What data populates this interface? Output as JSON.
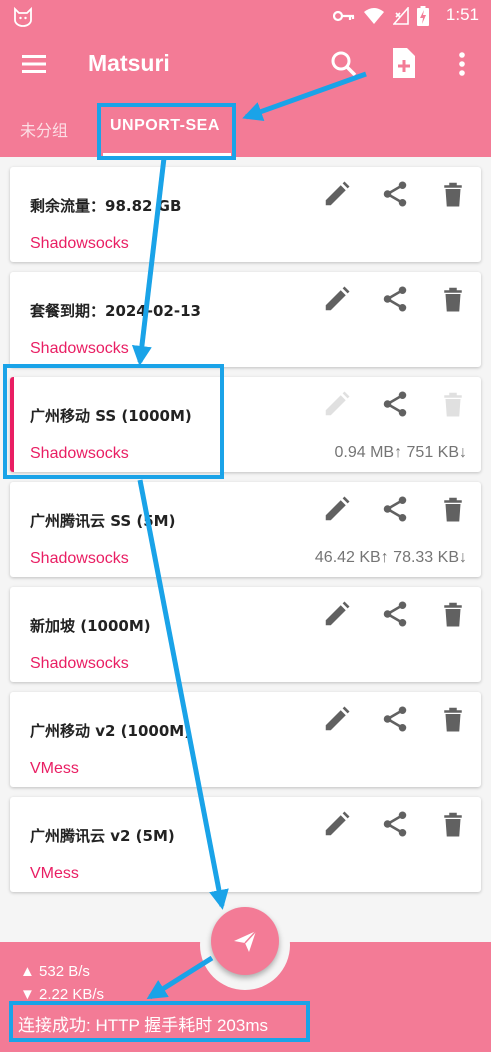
{
  "status_bar": {
    "time": "1:51",
    "icons": [
      "cat-icon",
      "key-icon",
      "wifi-icon",
      "no-sim-icon",
      "battery-charging-icon"
    ]
  },
  "app_bar": {
    "title": "Matsuri",
    "icons": [
      "menu-icon",
      "search-icon",
      "add-file-icon",
      "more-vert-icon"
    ]
  },
  "tabs": [
    {
      "label": "未分组",
      "active": false
    },
    {
      "label": "UNPORT-SEA",
      "active": true
    }
  ],
  "profiles": [
    {
      "name": "剩余流量：98.82 GB",
      "type": "Shadowsocks",
      "traffic": "",
      "selected": false
    },
    {
      "name": "套餐到期：2024-02-13",
      "type": "Shadowsocks",
      "traffic": "",
      "selected": false
    },
    {
      "name": "广州移动 SS (1000M)",
      "type": "Shadowsocks",
      "traffic": "0.94 MB↑ 751 KB↓",
      "selected": true
    },
    {
      "name": "广州腾讯云 SS (5M)",
      "type": "Shadowsocks",
      "traffic": "46.42 KB↑ 78.33 KB↓",
      "selected": false
    },
    {
      "name": "新加坡 (1000M)",
      "type": "Shadowsocks",
      "traffic": "",
      "selected": false
    },
    {
      "name": "广州移动 v2 (1000M)",
      "type": "VMess",
      "traffic": "",
      "selected": false
    },
    {
      "name": "广州腾讯云 v2 (5M)",
      "type": "VMess",
      "traffic": "",
      "selected": false
    }
  ],
  "bottom": {
    "up_speed": "▲ 532 B/s",
    "down_speed": "▼ 2.22 KB/s",
    "status": "连接成功: HTTP 握手耗时 203ms"
  },
  "colors": {
    "primary": "#f37b96",
    "accent": "#e91e63",
    "annotation": "#1aa3e8"
  }
}
